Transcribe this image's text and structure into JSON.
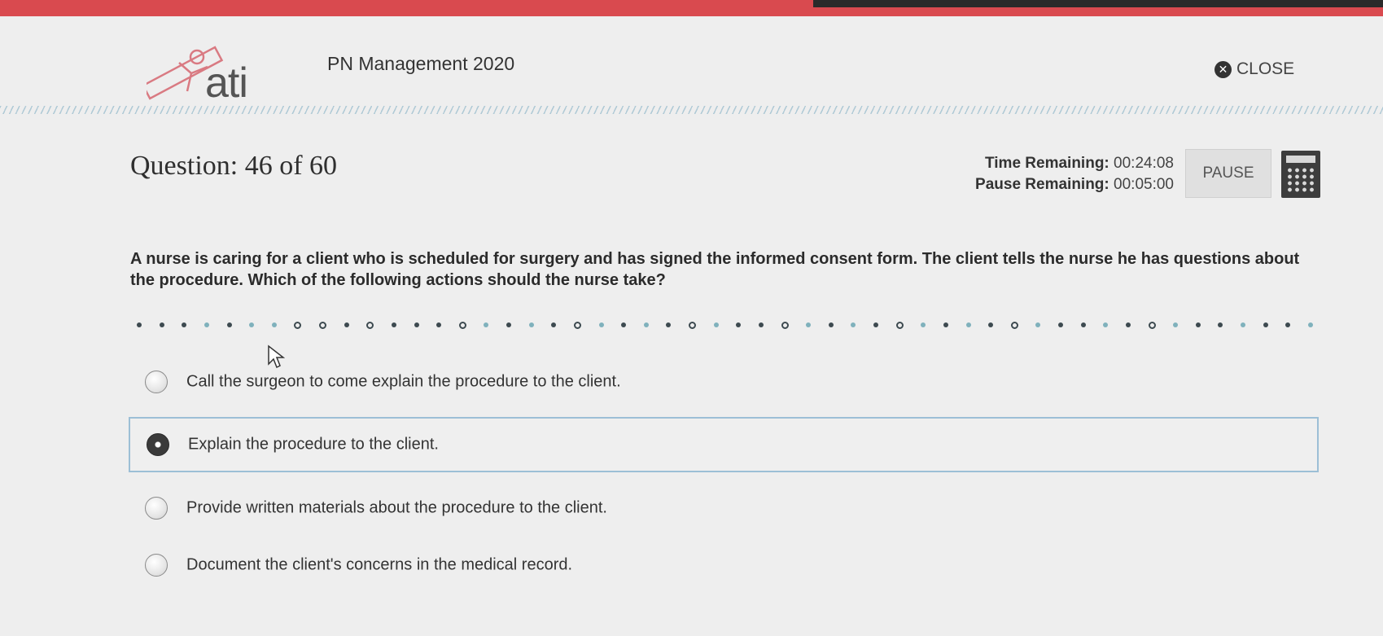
{
  "header": {
    "logo_text": "ati",
    "exam_title": "PN Management 2020",
    "close_label": "CLOSE"
  },
  "status": {
    "question_label": "Question: 46 of 60",
    "time_remaining_label": "Time Remaining:",
    "time_remaining_value": "00:24:08",
    "pause_remaining_label": "Pause Remaining:",
    "pause_remaining_value": "00:05:00",
    "pause_button_label": "PAUSE",
    "calculator_icon": "calculator-icon"
  },
  "question": {
    "stem": "A nurse is caring for a client who is scheduled for surgery and has signed the informed consent form. The client tells the nurse he has questions about the procedure. Which of the following actions should the nurse take?",
    "options": [
      {
        "text": "Call the surgeon to come explain the procedure to the client.",
        "selected": false
      },
      {
        "text": "Explain the procedure to the client.",
        "selected": true
      },
      {
        "text": "Provide written materials about the procedure to the client.",
        "selected": false
      },
      {
        "text": "Document the client's concerns in the medical record.",
        "selected": false
      }
    ]
  },
  "colors": {
    "accent_bar": "#d94a4f",
    "selected_border": "#9cbfd6",
    "hatch": "#a9c6d3"
  }
}
